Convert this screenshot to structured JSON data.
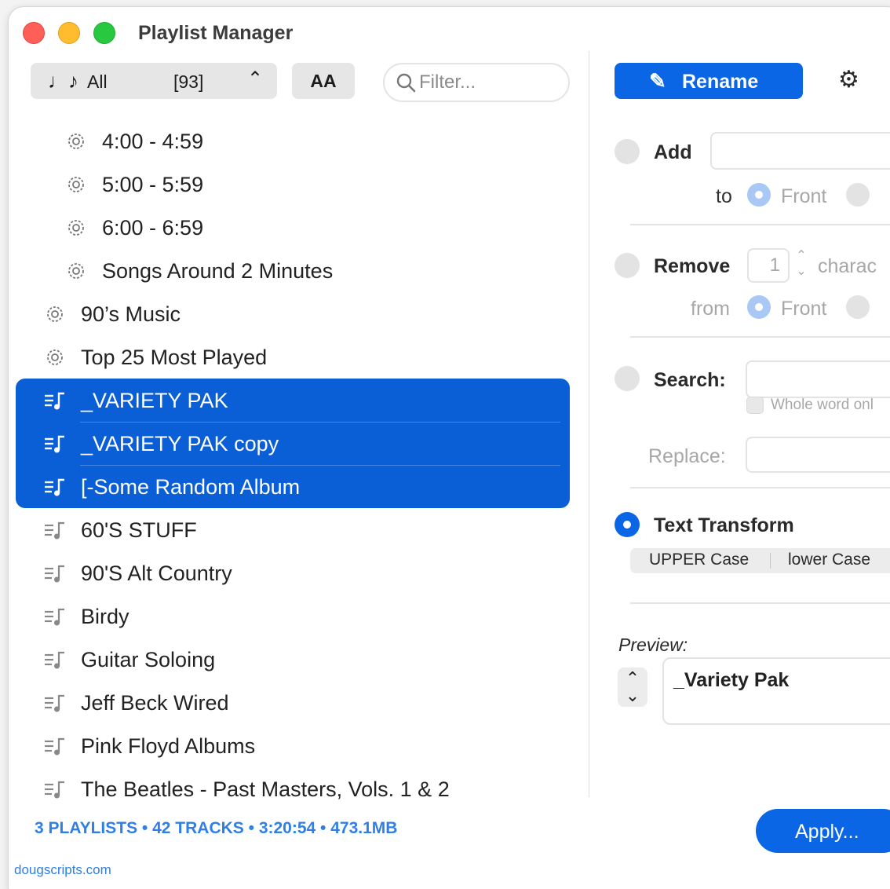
{
  "window": {
    "title": "Playlist Manager"
  },
  "toolbar": {
    "source_label": "All",
    "source_count": "[93]",
    "font_button": "AA",
    "filter_placeholder": "Filter..."
  },
  "playlists": [
    {
      "label": "4:00 - 4:59",
      "type": "smart",
      "level": 2,
      "selected": false
    },
    {
      "label": "5:00 - 5:59",
      "type": "smart",
      "level": 2,
      "selected": false
    },
    {
      "label": "6:00 - 6:59",
      "type": "smart",
      "level": 2,
      "selected": false
    },
    {
      "label": "Songs Around 2 Minutes",
      "type": "smart",
      "level": 2,
      "selected": false
    },
    {
      "label": "90’s Music",
      "type": "smart",
      "level": 1,
      "selected": false
    },
    {
      "label": "Top 25 Most Played",
      "type": "smart",
      "level": 1,
      "selected": false
    },
    {
      "label": "_VARIETY PAK",
      "type": "playlist",
      "level": 1,
      "selected": true
    },
    {
      "label": "_VARIETY PAK copy",
      "type": "playlist",
      "level": 1,
      "selected": true
    },
    {
      "label": "[-Some Random Album",
      "type": "playlist",
      "level": 1,
      "selected": true
    },
    {
      "label": "60'S STUFF",
      "type": "playlist",
      "level": 1,
      "selected": false
    },
    {
      "label": "90'S Alt Country",
      "type": "playlist",
      "level": 1,
      "selected": false
    },
    {
      "label": "Birdy",
      "type": "playlist",
      "level": 1,
      "selected": false
    },
    {
      "label": "Guitar Soloing",
      "type": "playlist",
      "level": 1,
      "selected": false
    },
    {
      "label": "Jeff Beck Wired",
      "type": "playlist",
      "level": 1,
      "selected": false
    },
    {
      "label": "Pink Floyd Albums",
      "type": "playlist",
      "level": 1,
      "selected": false
    },
    {
      "label": "The Beatles - Past Masters, Vols. 1 & 2",
      "type": "playlist",
      "level": 1,
      "selected": false
    }
  ],
  "status": {
    "summary": "3 PLAYLISTS • 42 TRACKS • 3:20:54 • 473.1MB"
  },
  "footer": {
    "site": "dougscripts.com"
  },
  "right": {
    "tab_rename": "Rename",
    "add": {
      "label": "Add",
      "to": "to",
      "front": "Front"
    },
    "remove": {
      "label": "Remove",
      "count": "1",
      "units": "charac",
      "from": "from",
      "front": "Front"
    },
    "search": {
      "label": "Search:",
      "whole_word": "Whole word onl",
      "replace": "Replace:"
    },
    "transform": {
      "label": "Text Transform",
      "upper": "UPPER Case",
      "lower": "lower Case"
    },
    "preview": {
      "label": "Preview:",
      "value": "_Variety Pak"
    },
    "apply": "Apply..."
  },
  "colors": {
    "accent": "#0a66e4",
    "selection": "#0a5fd6",
    "stats": "#2f7fe6"
  }
}
